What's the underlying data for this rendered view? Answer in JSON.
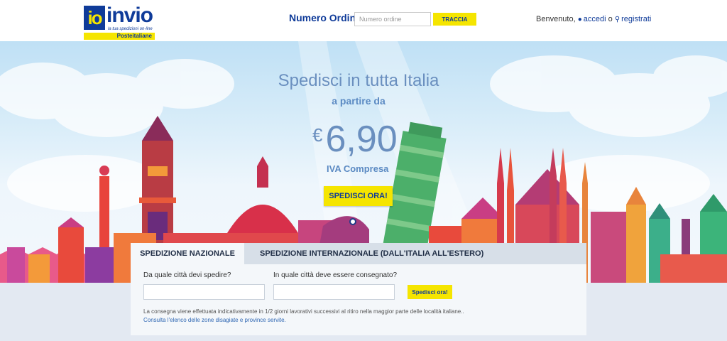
{
  "header": {
    "logo": {
      "main_left": "io",
      "main_right": "invio",
      "tagline": "la tua spedizioni on-line",
      "brand": "Posteitaliane"
    },
    "order": {
      "label": "Numero Ordine",
      "placeholder": "Numero ordine",
      "track_button": "TRACCIA"
    },
    "welcome": {
      "text": "Benvenuto,",
      "login": "accedi",
      "or": "o",
      "register": "registrati"
    }
  },
  "hero": {
    "title": "Spedisci in tutta Italia",
    "subtitle": "a partire da",
    "currency": "€",
    "price": "6,90",
    "vat": "IVA Compresa",
    "cta": "SPEDISCI ORA!"
  },
  "shipping": {
    "tabs": [
      "SPEDIZIONE NAZIONALE",
      "SPEDIZIONE INTERNAZIONALE (DALL'ITALIA ALL'ESTERO)"
    ],
    "from_label": "Da quale città devi spedire?",
    "to_label": "In quale città deve essere consegnato?",
    "button": "Spedisci ora!",
    "note": "La consegna viene effettuata indicativamente in 1/2 giorni lavorativi successivi al ritiro nella maggior parte delle località italiane..",
    "link": "Consulta l'elenco delle zone disagiate e province servite."
  },
  "colors": {
    "brand_blue": "#0f3b99",
    "brand_yellow": "#f5e500",
    "hero_text": "#6a8fbf"
  },
  "icons": [
    "user-icon",
    "key-icon"
  ]
}
